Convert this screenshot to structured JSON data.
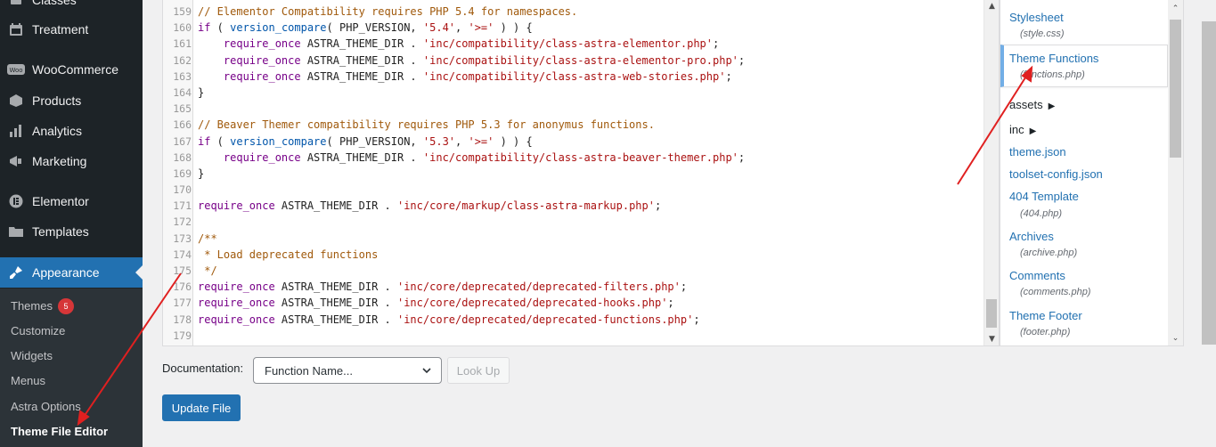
{
  "sidebar": {
    "items": [
      {
        "label": "Classes",
        "icon": "classes-icon"
      },
      {
        "label": "Treatment",
        "icon": "calendar-icon"
      },
      {
        "label": "WooCommerce",
        "icon": "woo-icon"
      },
      {
        "label": "Products",
        "icon": "products-icon"
      },
      {
        "label": "Analytics",
        "icon": "analytics-icon"
      },
      {
        "label": "Marketing",
        "icon": "megaphone-icon"
      },
      {
        "label": "Elementor",
        "icon": "elementor-icon"
      },
      {
        "label": "Templates",
        "icon": "folder-icon"
      },
      {
        "label": "Appearance",
        "icon": "brush-icon"
      }
    ],
    "submenu": [
      {
        "label": "Themes",
        "badge": "5"
      },
      {
        "label": "Customize"
      },
      {
        "label": "Widgets"
      },
      {
        "label": "Menus"
      },
      {
        "label": "Astra Options"
      },
      {
        "label": "Theme File Editor"
      }
    ]
  },
  "editor": {
    "lines": [
      {
        "n": "159",
        "code": "// Elementor Compatibility requires PHP 5.4 for namespaces."
      },
      {
        "n": "160",
        "code": "if ( version_compare( PHP_VERSION, '5.4', '>=' ) ) {"
      },
      {
        "n": "161",
        "code": "    require_once ASTRA_THEME_DIR . 'inc/compatibility/class-astra-elementor.php';"
      },
      {
        "n": "162",
        "code": "    require_once ASTRA_THEME_DIR . 'inc/compatibility/class-astra-elementor-pro.php';"
      },
      {
        "n": "163",
        "code": "    require_once ASTRA_THEME_DIR . 'inc/compatibility/class-astra-web-stories.php';"
      },
      {
        "n": "164",
        "code": "}"
      },
      {
        "n": "165",
        "code": ""
      },
      {
        "n": "166",
        "code": "// Beaver Themer compatibility requires PHP 5.3 for anonymus functions."
      },
      {
        "n": "167",
        "code": "if ( version_compare( PHP_VERSION, '5.3', '>=' ) ) {"
      },
      {
        "n": "168",
        "code": "    require_once ASTRA_THEME_DIR . 'inc/compatibility/class-astra-beaver-themer.php';"
      },
      {
        "n": "169",
        "code": "}"
      },
      {
        "n": "170",
        "code": ""
      },
      {
        "n": "171",
        "code": "require_once ASTRA_THEME_DIR . 'inc/core/markup/class-astra-markup.php';"
      },
      {
        "n": "172",
        "code": ""
      },
      {
        "n": "173",
        "code": "/**"
      },
      {
        "n": "174",
        "code": " * Load deprecated functions"
      },
      {
        "n": "175",
        "code": " */"
      },
      {
        "n": "176",
        "code": "require_once ASTRA_THEME_DIR . 'inc/core/deprecated/deprecated-filters.php';"
      },
      {
        "n": "177",
        "code": "require_once ASTRA_THEME_DIR . 'inc/core/deprecated/deprecated-hooks.php';"
      },
      {
        "n": "178",
        "code": "require_once ASTRA_THEME_DIR . 'inc/core/deprecated/deprecated-functions.php';"
      },
      {
        "n": "179",
        "code": ""
      }
    ]
  },
  "files": {
    "stylesheet": {
      "label": "Stylesheet",
      "sub": "(style.css)"
    },
    "functions": {
      "label": "Theme Functions",
      "sub": "(functions.php)"
    },
    "assets": {
      "label": "assets"
    },
    "inc": {
      "label": "inc"
    },
    "themejson": {
      "label": "theme.json"
    },
    "toolset": {
      "label": "toolset-config.json"
    },
    "tpl404": {
      "label": "404 Template",
      "sub": "(404.php)"
    },
    "archives": {
      "label": "Archives",
      "sub": "(archive.php)"
    },
    "comments": {
      "label": "Comments",
      "sub": "(comments.php)"
    },
    "footer": {
      "label": "Theme Footer",
      "sub": "(footer.php)"
    }
  },
  "documentation": {
    "label": "Documentation:",
    "selected": "Function Name...",
    "lookup": "Look Up"
  },
  "update_button": "Update File",
  "colors": {
    "sidebar_bg": "#1d2327",
    "accent": "#2271b1",
    "annotation": "#e02020"
  }
}
